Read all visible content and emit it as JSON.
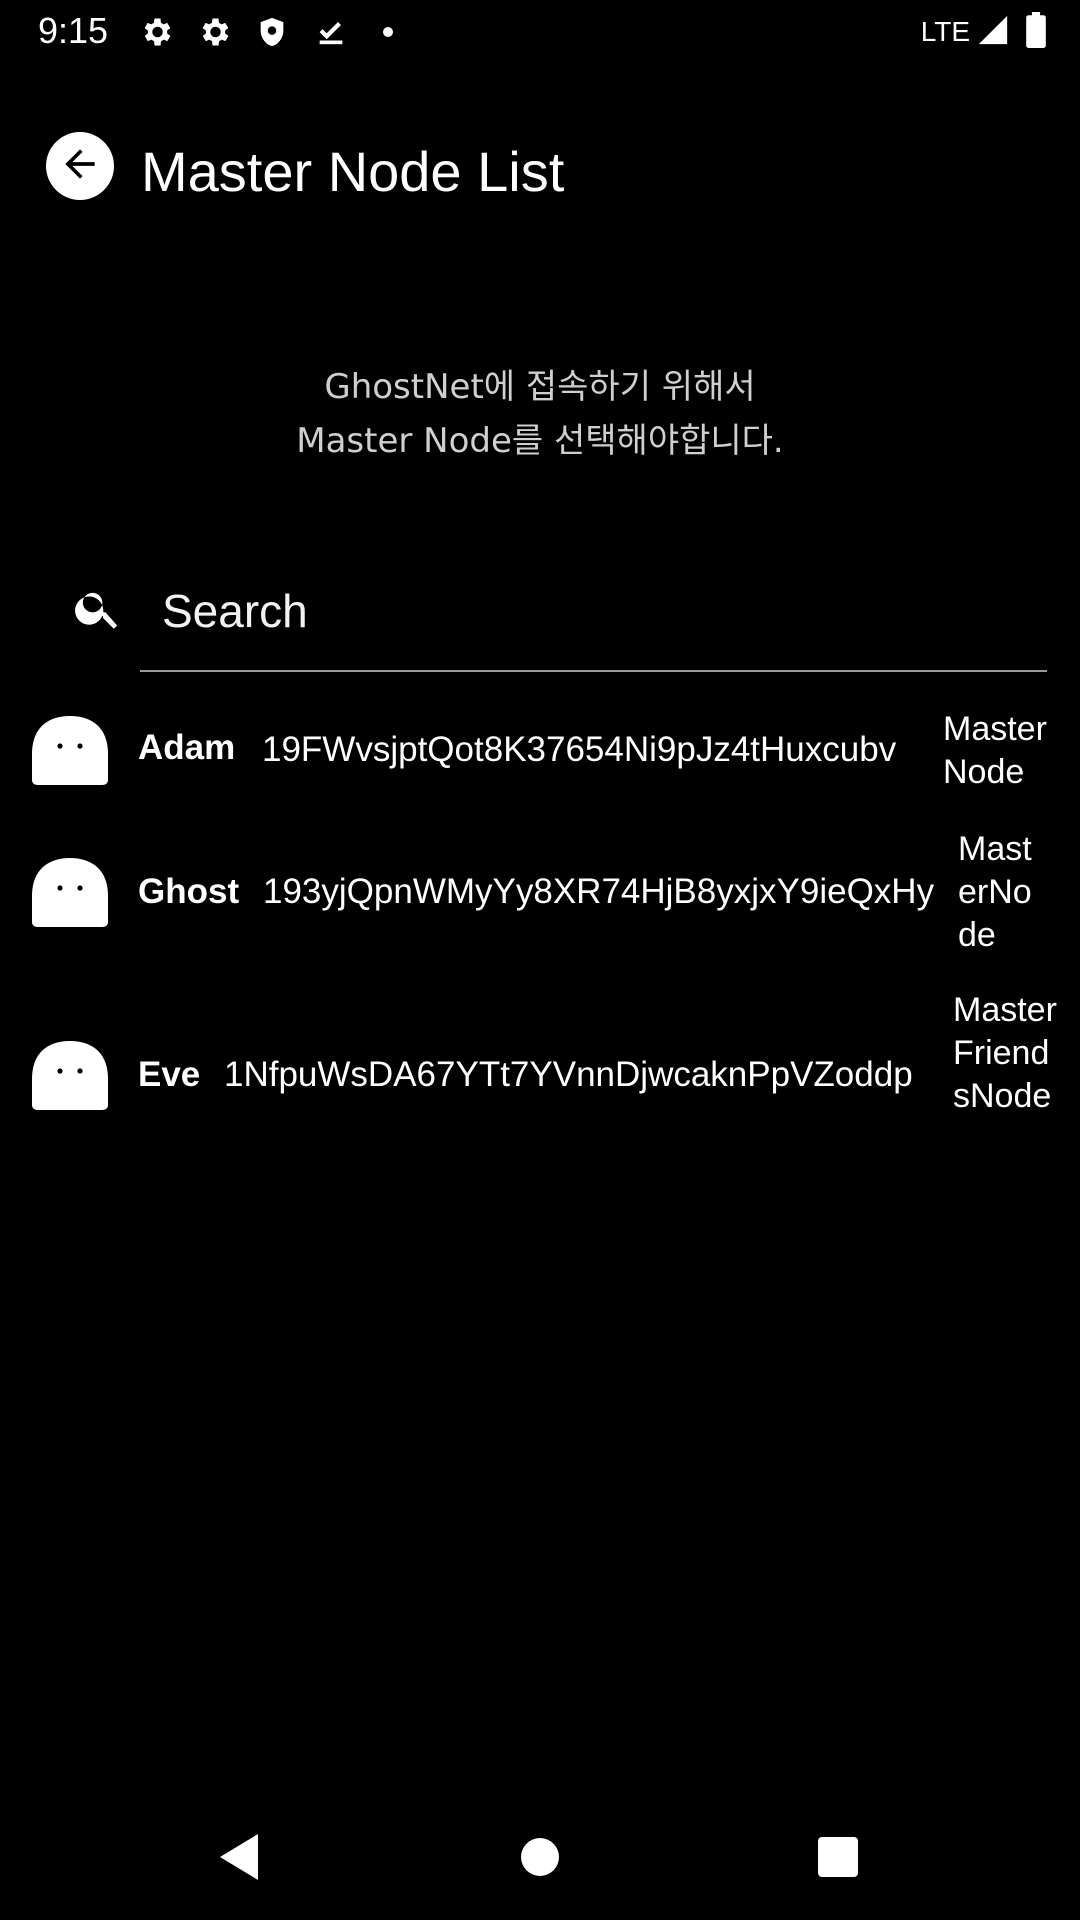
{
  "status_bar": {
    "time": "9:15",
    "icons": [
      "gear-icon",
      "gear-icon",
      "shield-icon",
      "download-done-icon",
      "dot-icon"
    ],
    "network": "LTE",
    "right_icons": [
      "signal-icon",
      "battery-icon"
    ]
  },
  "header": {
    "back_icon": "arrow-back-icon",
    "title": "Master Node List"
  },
  "subtitle": {
    "line1": "GhostNet에 접속하기 위해서",
    "line2": "Master Node를 선택해야합니다."
  },
  "search": {
    "icon": "search-icon",
    "placeholder": "Search",
    "value": ""
  },
  "nodes": [
    {
      "avatar": "ghost-avatar-icon",
      "name": "Adam",
      "address": "19FWvsjptQot8K37654Ni9pJz4tHuxcubv",
      "type": "MasterNode"
    },
    {
      "avatar": "ghost-avatar-icon",
      "name": "Ghost",
      "address": "193yjQpnWMyYy8XR74HjB8yxjxY9ieQxHy",
      "type": "MasterNode"
    },
    {
      "avatar": "ghost-avatar-icon",
      "name": "Eve",
      "address": "1NfpuWsDA67YTt7YVnnDjwcaknPpVZoddp",
      "type": "MasterFriendsNode"
    }
  ],
  "nav_bar": {
    "icons": [
      "nav-back-icon",
      "nav-home-icon",
      "nav-recents-icon"
    ]
  }
}
